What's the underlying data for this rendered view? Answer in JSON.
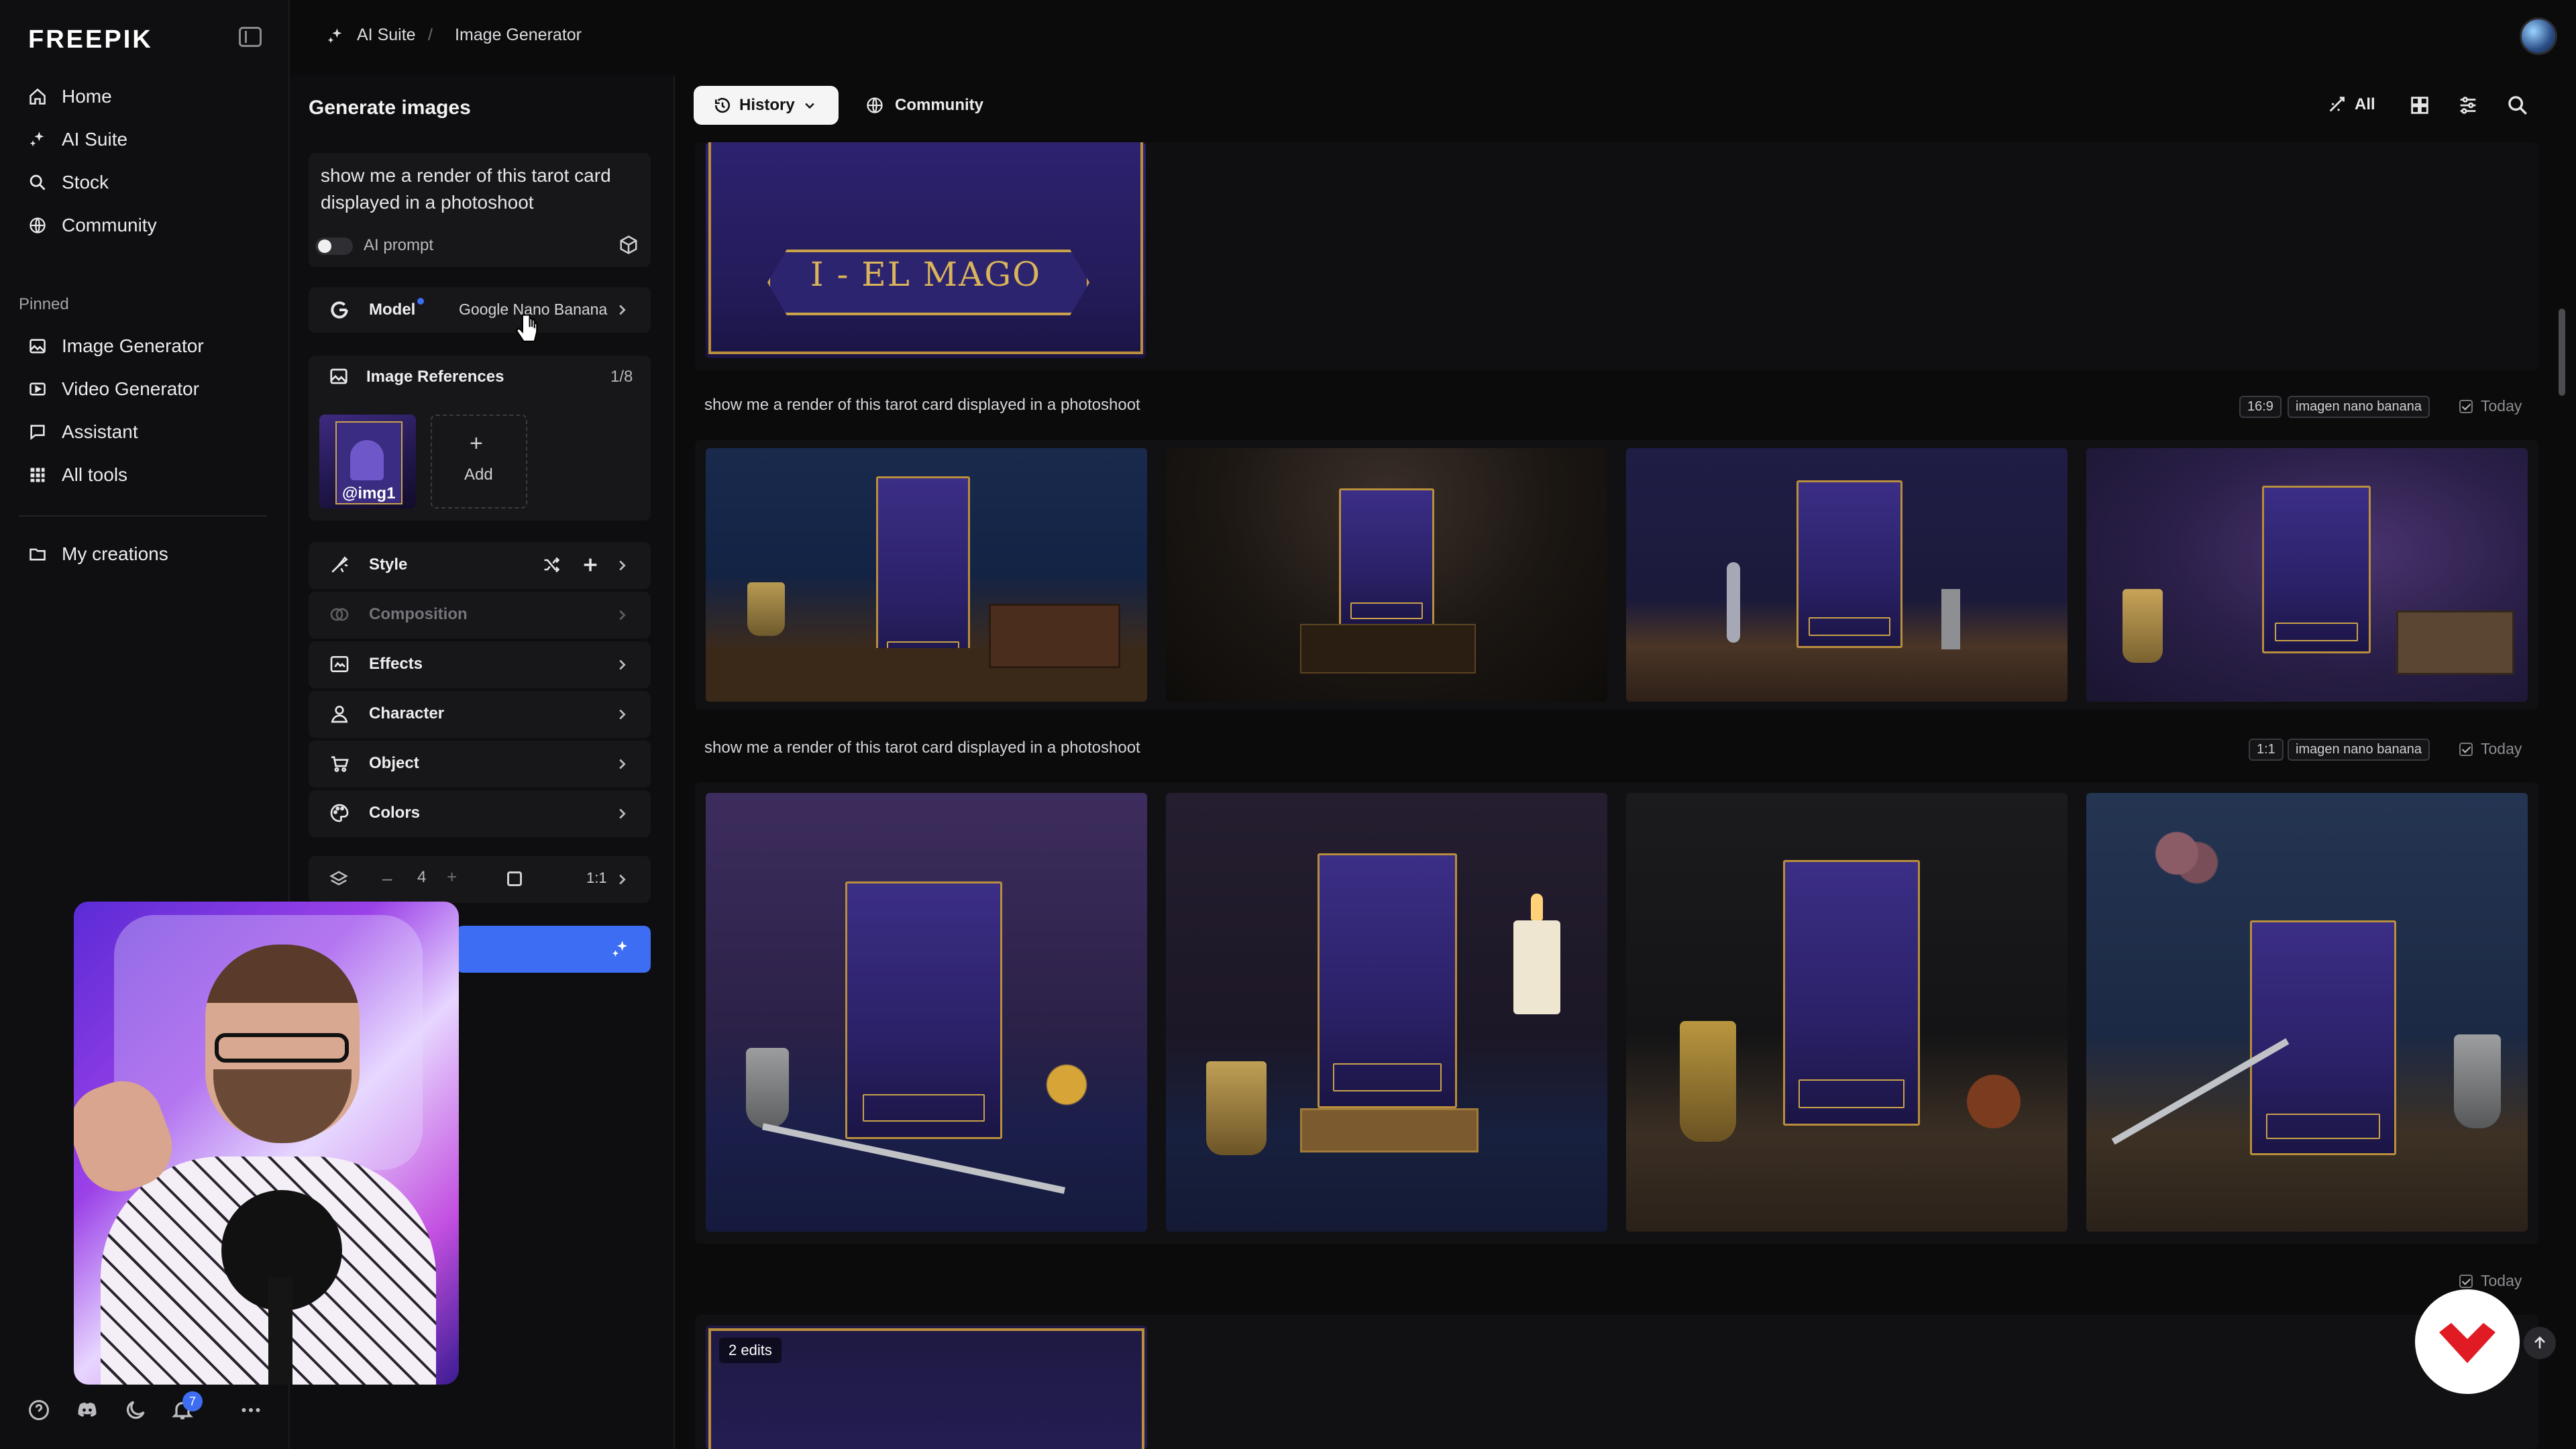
{
  "app": {
    "logo": "FREEPIK"
  },
  "breadcrumb": {
    "root": "AI Suite",
    "separator": "/",
    "current": "Image Generator"
  },
  "sidebar": {
    "main_items": [
      {
        "label": "Home",
        "icon": "home-icon"
      },
      {
        "label": "AI Suite",
        "icon": "sparkle-icon"
      },
      {
        "label": "Stock",
        "icon": "search-icon"
      },
      {
        "label": "Community",
        "icon": "globe-icon"
      }
    ],
    "pinned_label": "Pinned",
    "pinned_items": [
      {
        "label": "Image Generator",
        "icon": "image-icon"
      },
      {
        "label": "Video Generator",
        "icon": "video-icon"
      },
      {
        "label": "Assistant",
        "icon": "chat-icon"
      },
      {
        "label": "All tools",
        "icon": "grid-icon"
      }
    ],
    "creations": {
      "label": "My creations",
      "icon": "folder-icon"
    },
    "footer": {
      "notification_count": "7"
    }
  },
  "panel": {
    "title": "Generate images",
    "prompt": {
      "value": "show me a render of this tarot card displayed in a photoshoot",
      "ai_prompt_label": "AI prompt"
    },
    "model": {
      "label": "Model",
      "value": "Google Nano Banana"
    },
    "image_references": {
      "label": "Image References",
      "count": "1/8",
      "thumb_label": "@img1",
      "add_label": "Add",
      "add_plus": "+"
    },
    "settings": [
      {
        "label": "Style",
        "icon": "style-icon",
        "enabled": true
      },
      {
        "label": "Composition",
        "icon": "composition-icon",
        "enabled": false
      },
      {
        "label": "Effects",
        "icon": "effects-icon",
        "enabled": true
      },
      {
        "label": "Character",
        "icon": "character-icon",
        "enabled": true
      },
      {
        "label": "Object",
        "icon": "object-icon",
        "enabled": true
      },
      {
        "label": "Colors",
        "icon": "palette-icon",
        "enabled": true
      }
    ],
    "quantity": {
      "minus": "–",
      "value": "4",
      "plus": "+"
    },
    "aspect_ratio": "1:1"
  },
  "main": {
    "history_label": "History",
    "community_label": "Community",
    "filter_all": "All",
    "groups": [
      {
        "caption": "show me a render of this tarot card displayed in a photoshoot",
        "ratio": "16:9",
        "model": "imagen nano banana",
        "date": "Today"
      },
      {
        "caption": "show me a render of this tarot card displayed in a photoshoot",
        "ratio": "1:1",
        "model": "imagen nano banana",
        "date": "Today"
      },
      {
        "date": "Today",
        "edits_label": "2 edits"
      }
    ],
    "top_card_text": "I - EL MAGO"
  },
  "colors": {
    "accent": "#3d6df2",
    "background": "#0b0b0c",
    "panel": "#17171a",
    "gold": "#c9a24a",
    "card_purple": "#2b2168"
  }
}
